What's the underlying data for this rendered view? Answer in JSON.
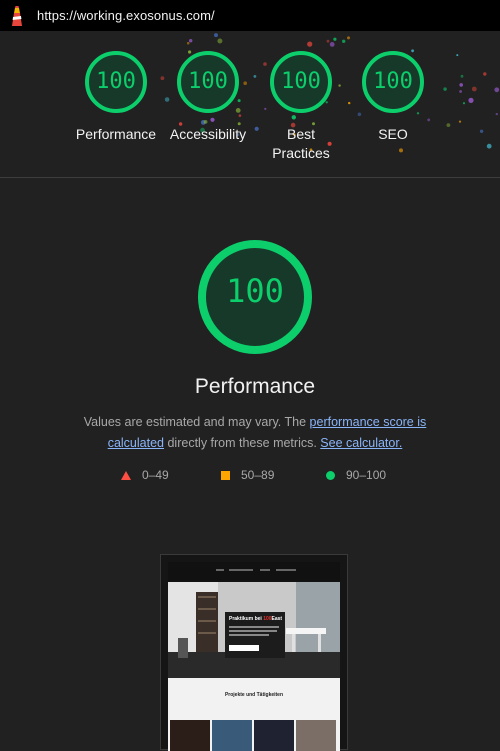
{
  "topbar": {
    "url": "https://working.exosonus.com/",
    "logo_icon": "lighthouse-icon"
  },
  "categories": [
    {
      "score": "100",
      "label": "Performance"
    },
    {
      "score": "100",
      "label": "Accessibility"
    },
    {
      "score": "100",
      "label": "Best Practices"
    },
    {
      "score": "100",
      "label": "SEO"
    }
  ],
  "main": {
    "score": "100",
    "title": "Performance",
    "desc_before": "Values are estimated and may vary. The ",
    "desc_link1": "performance score is calculated",
    "desc_middle": " directly from these metrics. ",
    "desc_link2": "See calculator."
  },
  "legend": [
    {
      "range": "0–49",
      "icon": "triangle-icon",
      "color": "#ff4e42"
    },
    {
      "range": "50–89",
      "icon": "square-icon",
      "color": "#ffa400"
    },
    {
      "range": "90–100",
      "icon": "circle-icon",
      "color": "#0cce6b"
    }
  ],
  "thumbnail": {
    "hero_title_before": "Praktikum bei ",
    "hero_title_highlight": "100",
    "hero_title_after": "East",
    "section_title": "Projekte und Tätigkeiten"
  },
  "colors": {
    "pass": "#0cce6b",
    "background": "#212121",
    "link": "#8ab4f8"
  }
}
